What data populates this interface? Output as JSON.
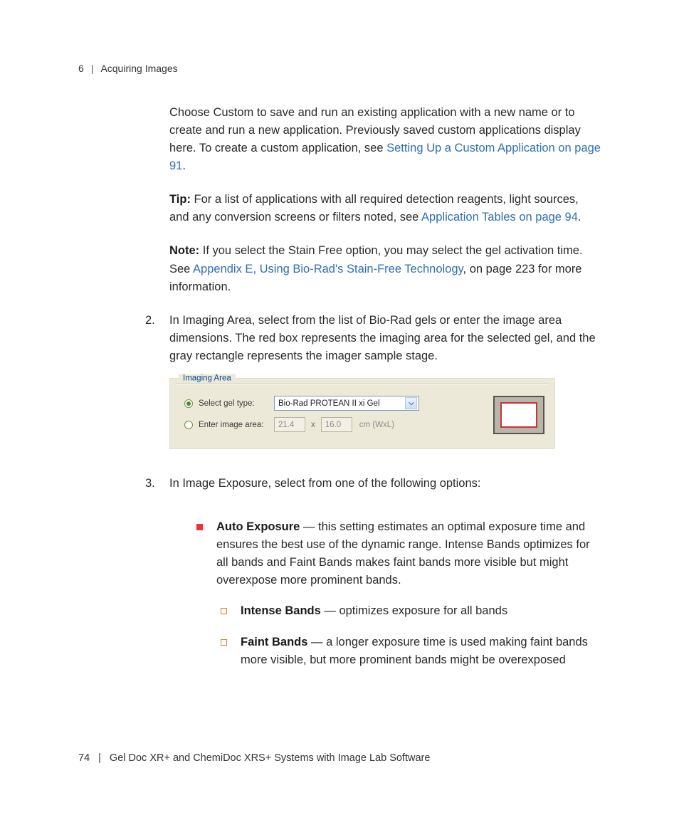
{
  "header": {
    "chapter": "6",
    "title": "Acquiring Images"
  },
  "intro": {
    "p1a": "Choose Custom to save and run an existing application with a new name or to create and run a new application. Previously saved custom applications display here. To create a custom application, see ",
    "p1link": "Setting Up a Custom Application on page 91",
    "p1b": ".",
    "tipLabel": "Tip:",
    "tipA": "   For a list of applications with all required detection reagents, light sources, and any conversion screens or filters noted, see ",
    "tipLink": "Application Tables on page 94",
    "tipB": ".",
    "noteLabel": "Note:",
    "noteA": "  If you select the Stain Free option, you may select the gel activation time. See ",
    "noteLink": "Appendix E, Using Bio-Rad's Stain-Free Technology",
    "noteB": ", on page 223 for more information."
  },
  "step2": {
    "num": "2.",
    "text": "In Imaging Area, select from the list of Bio-Rad gels or enter the image area dimensions. The red box represents the imaging area for the selected gel, and the gray rectangle represents the imager sample stage."
  },
  "panel": {
    "title": "Imaging Area",
    "opt1": "Select gel type:",
    "opt2": "Enter image area:",
    "selectValue": "Bio-Rad PROTEAN II xi Gel",
    "w": "21.4",
    "x": "x",
    "l": "16.0",
    "unit": "cm (WxL)"
  },
  "step3": {
    "num": "3.",
    "text": "In Image Exposure, select from one of the following options:"
  },
  "bullets": {
    "autoTitle": "Auto Exposure",
    "autoText": " — this setting estimates an optimal exposure time and ensures the best use of the dynamic range. Intense Bands optimizes for all bands and Faint Bands makes faint bands more visible but might overexpose more prominent bands.",
    "intenseTitle": "Intense Bands",
    "intenseText": " — optimizes exposure for all bands",
    "faintTitle": "Faint Bands",
    "faintText": " — a longer exposure time is used making faint bands more visible, but more prominent bands might be overexposed"
  },
  "footer": {
    "page": "74",
    "title": "Gel Doc XR+ and ChemiDoc XRS+ Systems with Image Lab Software"
  }
}
